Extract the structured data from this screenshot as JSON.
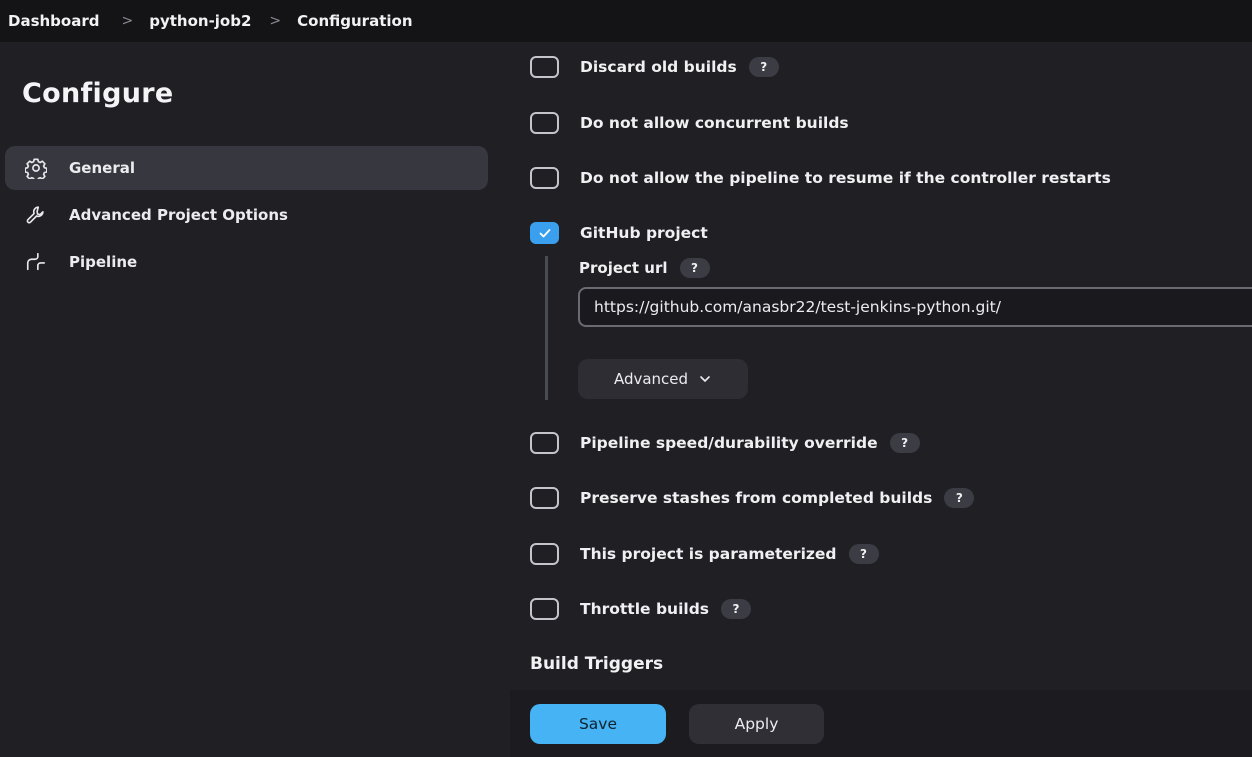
{
  "breadcrumb": {
    "items": [
      "Dashboard",
      "python-job2",
      "Configuration"
    ],
    "separator": ">"
  },
  "sidebar": {
    "title": "Configure",
    "items": [
      {
        "label": "General",
        "icon": "gear-icon",
        "active": true
      },
      {
        "label": "Advanced Project Options",
        "icon": "wrench-icon",
        "active": false
      },
      {
        "label": "Pipeline",
        "icon": "pipeline-icon",
        "active": false
      }
    ]
  },
  "general": {
    "options": [
      {
        "label": "Discard old builds",
        "checked": false,
        "help": "?"
      },
      {
        "label": "Do not allow concurrent builds",
        "checked": false
      },
      {
        "label": "Do not allow the pipeline to resume if the controller restarts",
        "checked": false
      },
      {
        "label": "GitHub project",
        "checked": true
      },
      {
        "label": "Pipeline speed/durability override",
        "checked": false,
        "help": "?"
      },
      {
        "label": "Preserve stashes from completed builds",
        "checked": false,
        "help": "?"
      },
      {
        "label": "This project is parameterized",
        "checked": false,
        "help": "?"
      },
      {
        "label": "Throttle builds",
        "checked": false,
        "help": "?"
      }
    ],
    "github": {
      "project_url_label": "Project url",
      "project_url_help": "?",
      "project_url_value": "https://github.com/anasbr22/test-jenkins-python.git/",
      "advanced_label": "Advanced"
    }
  },
  "build_triggers": {
    "title": "Build Triggers"
  },
  "footer": {
    "save_label": "Save",
    "apply_label": "Apply"
  },
  "colors": {
    "accent": "#46b3f4",
    "checkbox_checked": "#3aa0ee",
    "background": "#1f1f24",
    "topbar": "#141417"
  }
}
